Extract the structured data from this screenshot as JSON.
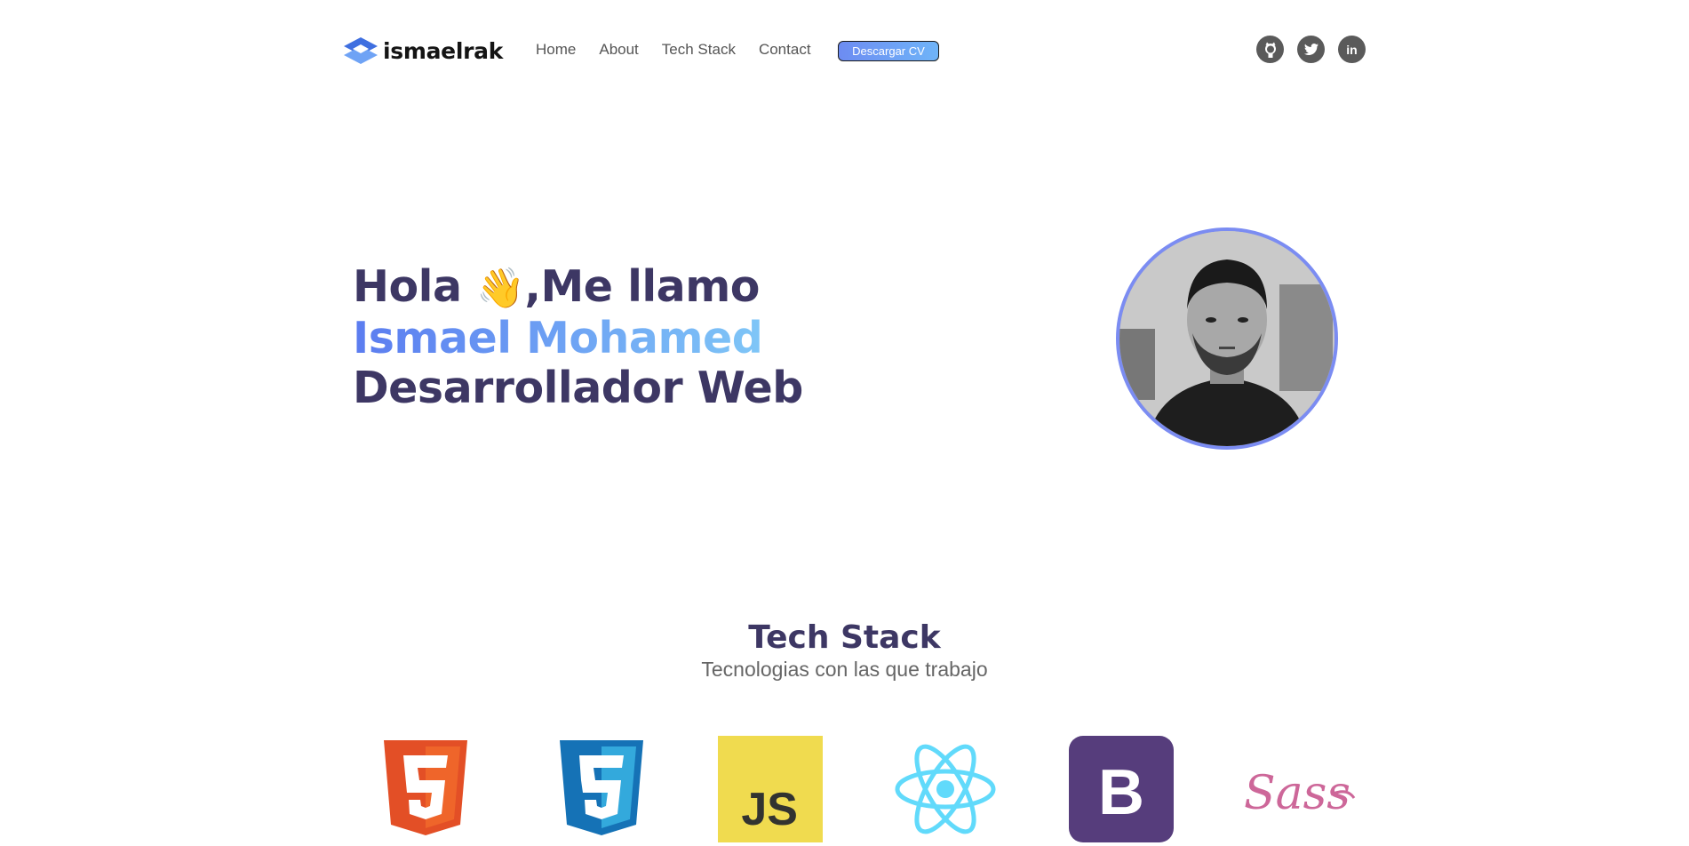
{
  "brand": {
    "name": "ismaelrak"
  },
  "nav": {
    "items": [
      "Home",
      "About",
      "Tech Stack",
      "Contact"
    ],
    "cv_button": "Descargar CV"
  },
  "social": {
    "icons": [
      "github-icon",
      "twitter-icon",
      "linkedin-icon"
    ],
    "linkedin_text": "in"
  },
  "hero": {
    "greeting": "Hola",
    "wave_emoji": "👋",
    "intro": ",Me llamo",
    "name": "Ismael Mohamed",
    "role": "Desarrollador Web"
  },
  "tech_stack": {
    "title": "Tech Stack",
    "subtitle": "Tecnologias con las que trabajo",
    "items": [
      {
        "icon": "html5-icon",
        "color": "#e34f26"
      },
      {
        "icon": "css3-icon",
        "color": "#1572b6"
      },
      {
        "icon": "javascript-icon",
        "color": "#f0db4f",
        "text": "JS"
      },
      {
        "icon": "react-icon",
        "color": "#61dafb"
      },
      {
        "icon": "bootstrap-icon",
        "color": "#563d7c",
        "text": "B"
      },
      {
        "icon": "sass-icon",
        "color": "#cd6799",
        "text": "Sass"
      }
    ]
  },
  "colors": {
    "heading": "#3d3764",
    "accent_start": "#5b7cf0",
    "accent_end": "#7fc6f7",
    "avatar_ring": "#7b8cf2"
  }
}
